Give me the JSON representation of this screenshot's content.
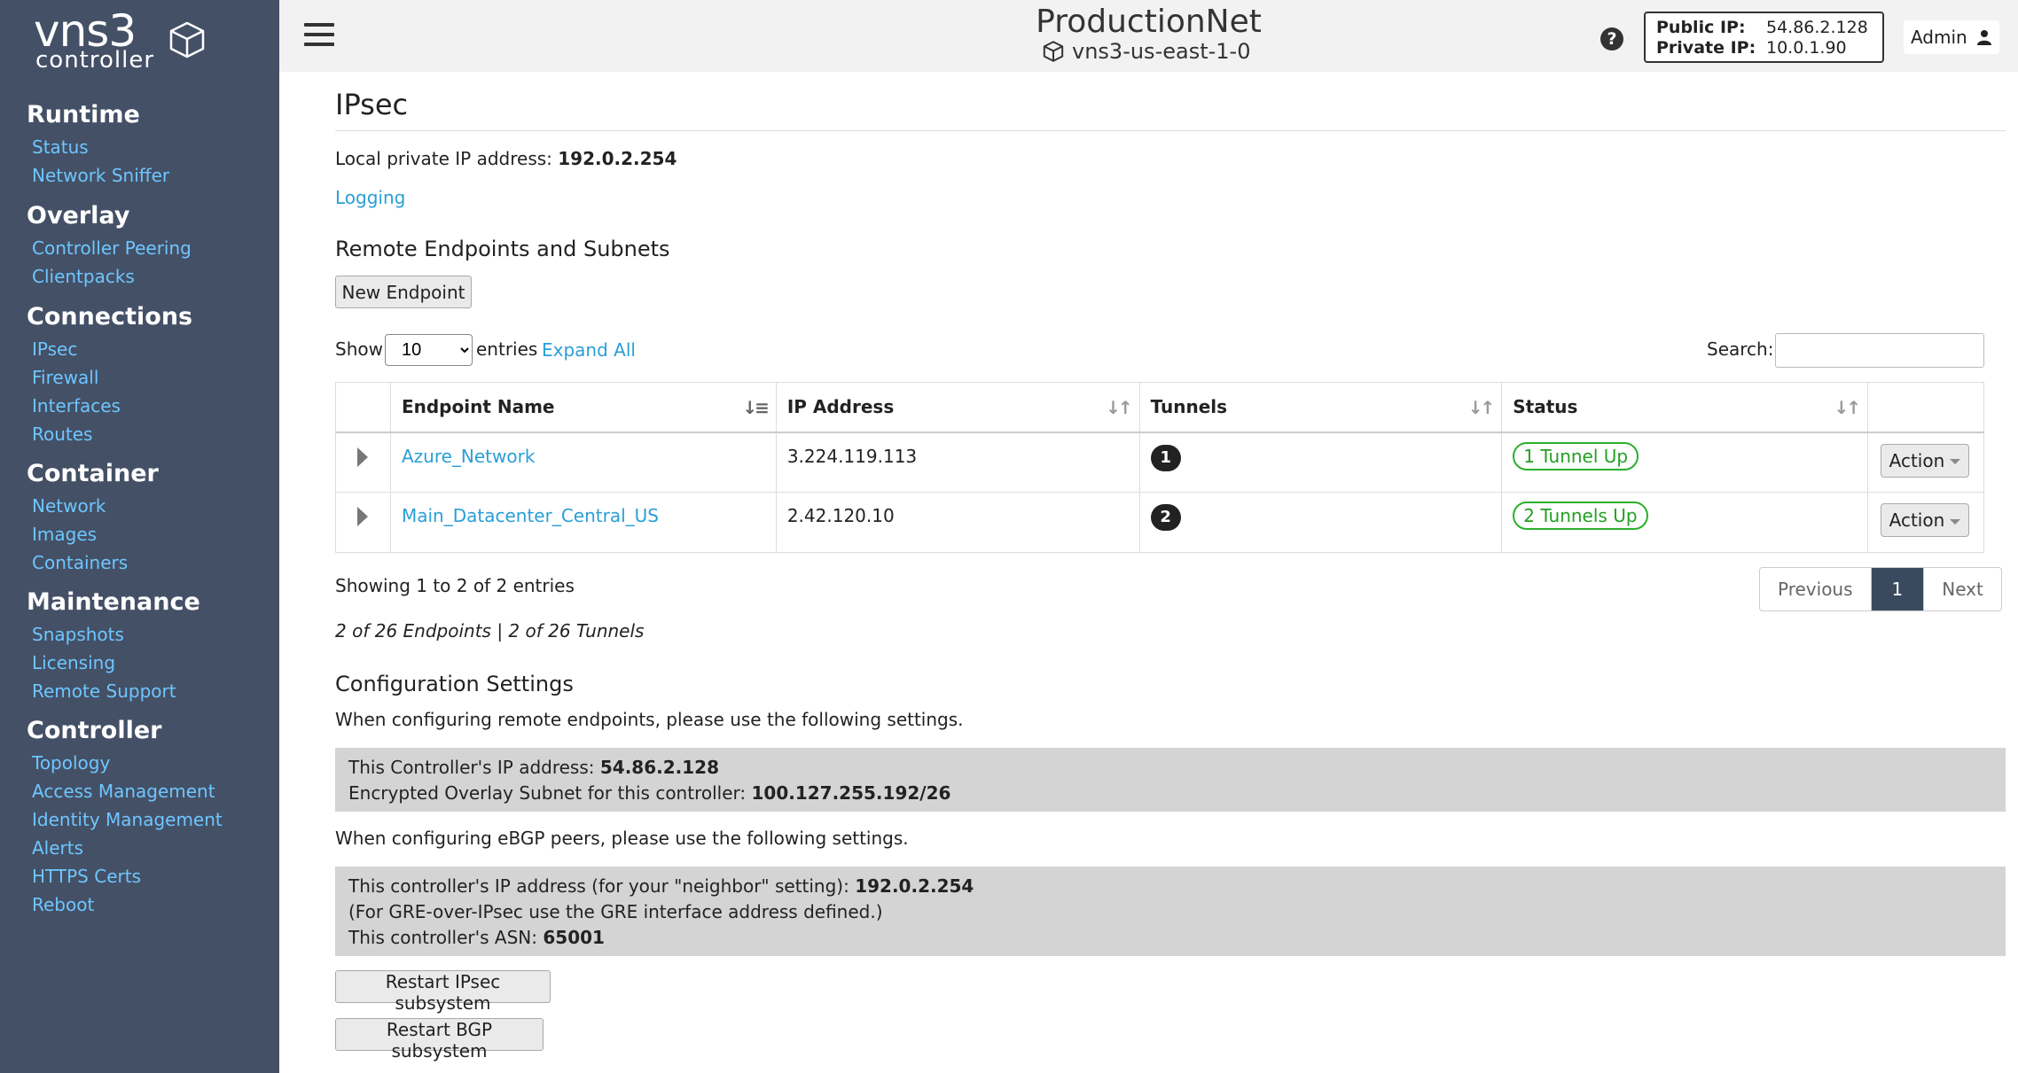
{
  "brand": {
    "name": "vns3",
    "sub": "controller"
  },
  "sidebar": {
    "sections": [
      {
        "heading": "Runtime",
        "items": [
          "Status",
          "Network Sniffer"
        ]
      },
      {
        "heading": "Overlay",
        "items": [
          "Controller Peering",
          "Clientpacks"
        ]
      },
      {
        "heading": "Connections",
        "items": [
          "IPsec",
          "Firewall",
          "Interfaces",
          "Routes"
        ]
      },
      {
        "heading": "Container",
        "items": [
          "Network",
          "Images",
          "Containers"
        ]
      },
      {
        "heading": "Maintenance",
        "items": [
          "Snapshots",
          "Licensing",
          "Remote Support"
        ]
      },
      {
        "heading": "Controller",
        "items": [
          "Topology",
          "Access Management",
          "Identity Management",
          "Alerts",
          "HTTPS Certs",
          "Reboot"
        ]
      }
    ]
  },
  "header": {
    "title": "ProductionNet",
    "subtitle": "vns3-us-east-1-0",
    "help": "?",
    "public_ip_label": "Public IP:",
    "public_ip": "54.86.2.128",
    "private_ip_label": "Private IP:",
    "private_ip": "10.0.1.90",
    "user": "Admin"
  },
  "page": {
    "title": "IPsec",
    "local_ip_label": "Local private IP address:",
    "local_ip": "192.0.2.254",
    "logging_link": "Logging",
    "remote_heading": "Remote Endpoints and Subnets",
    "new_endpoint": "New Endpoint",
    "show_label": "Show",
    "entries_value": "10",
    "entries_label": "entries",
    "expand_all": "Expand All",
    "search_label": "Search:",
    "search_value": ""
  },
  "table": {
    "columns": [
      "Endpoint Name",
      "IP Address",
      "Tunnels",
      "Status"
    ],
    "rows": [
      {
        "name": "Azure_Network",
        "ip": "3.224.119.113",
        "tunnels": "1",
        "status": "1 Tunnel Up",
        "action": "Action"
      },
      {
        "name": "Main_Datacenter_Central_US",
        "ip": "2.42.120.10",
        "tunnels": "2",
        "status": "2 Tunnels Up",
        "action": "Action"
      }
    ],
    "info": "Showing 1 to 2 of 2 entries",
    "summary": "2 of 26 Endpoints | 2 of 26 Tunnels",
    "pager": {
      "prev": "Previous",
      "current": "1",
      "next": "Next"
    }
  },
  "config": {
    "heading": "Configuration Settings",
    "remote_intro": "When configuring remote endpoints, please use the following settings.",
    "ctrl_ip_label": "This Controller's IP address:",
    "ctrl_ip": "54.86.2.128",
    "overlay_label": "Encrypted Overlay Subnet for this controller:",
    "overlay_subnet": "100.127.255.192/26",
    "bgp_intro": "When configuring eBGP peers, please use the following settings.",
    "neighbor_label": "This controller's IP address (for your \"neighbor\" setting):",
    "neighbor_ip": "192.0.2.254",
    "gre_note": "(For GRE-over-IPsec use the GRE interface address defined.)",
    "asn_label": "This controller's ASN:",
    "asn": "65001",
    "restart_ipsec": "Restart IPsec subsystem",
    "restart_bgp": "Restart BGP subsystem"
  },
  "colors": {
    "sidebar": "#445066",
    "link": "#2a9fd6",
    "status_green": "#23a023",
    "pager_active": "#3a4a5e"
  }
}
